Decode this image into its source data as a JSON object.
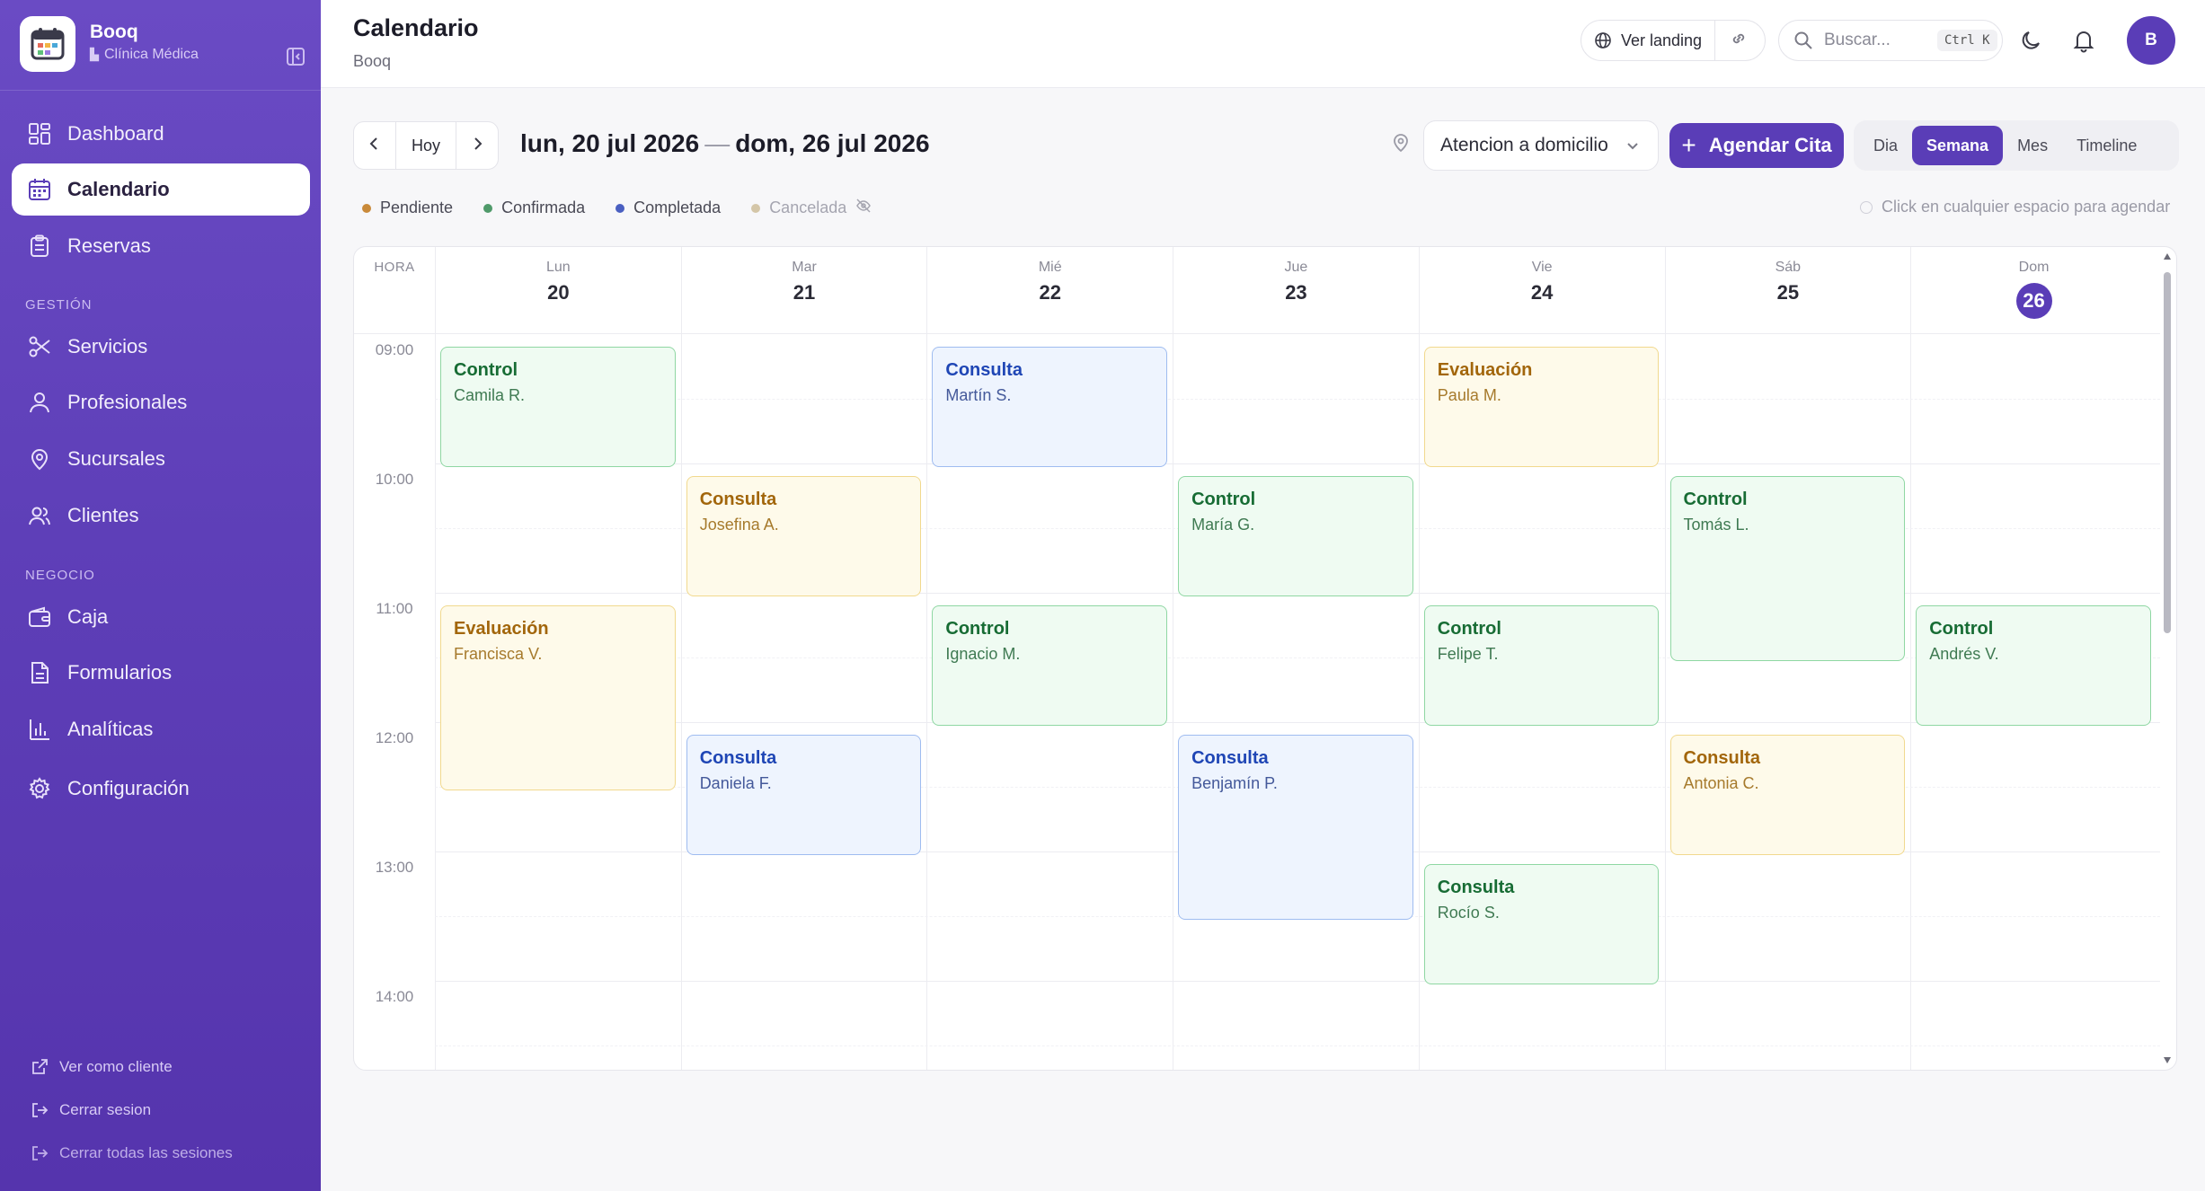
{
  "sidebar": {
    "brand_name": "Booq",
    "brand_sub": "Clínica Médica",
    "items": [
      {
        "label": "Dashboard",
        "icon": "dashboard-icon"
      },
      {
        "label": "Calendario",
        "icon": "calendar-icon",
        "active": true
      },
      {
        "label": "Reservas",
        "icon": "clipboard-icon"
      },
      {
        "label": "Servicios",
        "icon": "scissors-icon"
      },
      {
        "label": "Profesionales",
        "icon": "user-icon"
      },
      {
        "label": "Sucursales",
        "icon": "map-pin-icon"
      },
      {
        "label": "Clientes",
        "icon": "users-icon"
      },
      {
        "label": "Caja",
        "icon": "wallet-icon"
      },
      {
        "label": "Formularios",
        "icon": "document-icon"
      },
      {
        "label": "Analíticas",
        "icon": "bar-chart-icon"
      },
      {
        "label": "Configuración",
        "icon": "gear-icon"
      }
    ],
    "section_gestion": "GESTIÓN",
    "section_negocio": "NEGOCIO",
    "footer": [
      "Ver como cliente",
      "Cerrar sesion",
      "Cerrar todas las sesiones"
    ]
  },
  "header": {
    "title": "Calendario",
    "subtitle": "Booq",
    "landing_label": "Ver landing",
    "search_placeholder": "Buscar...",
    "shortcut": "Ctrl K",
    "avatar_initial": "B"
  },
  "toolbar": {
    "today_label": "Hoy",
    "range_start": "lun, 20 jul 2026",
    "range_sep": "—",
    "range_end": "dom, 26 jul 2026",
    "location": "Atencion a domicilio",
    "add_label": "Agendar Cita",
    "views": [
      "Dia",
      "Semana",
      "Mes",
      "Timeline"
    ],
    "active_view": "Semana"
  },
  "legend": {
    "items": [
      {
        "label": "Pendiente",
        "color": "#c98a3a"
      },
      {
        "label": "Confirmada",
        "color": "#4f9a6a"
      },
      {
        "label": "Completada",
        "color": "#4a5fc1"
      },
      {
        "label": "Cancelada",
        "color": "#d4c6a8"
      }
    ],
    "hint": "Click en cualquier espacio para agendar"
  },
  "calendar": {
    "hour_header": "HORA",
    "days": [
      {
        "name": "Lun",
        "num": "20"
      },
      {
        "name": "Mar",
        "num": "21"
      },
      {
        "name": "Mié",
        "num": "22"
      },
      {
        "name": "Jue",
        "num": "23"
      },
      {
        "name": "Vie",
        "num": "24"
      },
      {
        "name": "Sáb",
        "num": "25"
      },
      {
        "name": "Dom",
        "num": "26",
        "today": true
      }
    ],
    "hours": [
      "09:00",
      "10:00",
      "11:00",
      "12:00",
      "13:00",
      "14:00"
    ],
    "events": [
      {
        "day": 0,
        "start": 9,
        "dur": 1,
        "title": "Control",
        "client": "Camila R.",
        "color": "green"
      },
      {
        "day": 0,
        "start": 11,
        "dur": 1.5,
        "title": "Evaluación",
        "client": "Francisca V.",
        "color": "yellow"
      },
      {
        "day": 1,
        "start": 10,
        "dur": 1,
        "title": "Consulta",
        "client": "Josefina A.",
        "color": "yellow"
      },
      {
        "day": 1,
        "start": 12,
        "dur": 1,
        "title": "Consulta",
        "client": "Daniela F.",
        "color": "blue"
      },
      {
        "day": 2,
        "start": 9,
        "dur": 1,
        "title": "Consulta",
        "client": "Martín S.",
        "color": "blue"
      },
      {
        "day": 2,
        "start": 11,
        "dur": 1,
        "title": "Control",
        "client": "Ignacio M.",
        "color": "green"
      },
      {
        "day": 3,
        "start": 10,
        "dur": 1,
        "title": "Control",
        "client": "María G.",
        "color": "green"
      },
      {
        "day": 3,
        "start": 12,
        "dur": 1.5,
        "title": "Consulta",
        "client": "Benjamín P.",
        "color": "blue"
      },
      {
        "day": 4,
        "start": 9,
        "dur": 1,
        "title": "Evaluación",
        "client": "Paula M.",
        "color": "yellow"
      },
      {
        "day": 4,
        "start": 11,
        "dur": 1,
        "title": "Control",
        "client": "Felipe T.",
        "color": "green"
      },
      {
        "day": 4,
        "start": 13,
        "dur": 1,
        "title": "Consulta",
        "client": "Rocío S.",
        "color": "green"
      },
      {
        "day": 5,
        "start": 10,
        "dur": 1.5,
        "title": "Control",
        "client": "Tomás L.",
        "color": "green"
      },
      {
        "day": 5,
        "start": 12,
        "dur": 1,
        "title": "Consulta",
        "client": "Antonia C.",
        "color": "yellow"
      },
      {
        "day": 6,
        "start": 11,
        "dur": 1,
        "title": "Control",
        "client": "Andrés V.",
        "color": "green"
      }
    ]
  }
}
